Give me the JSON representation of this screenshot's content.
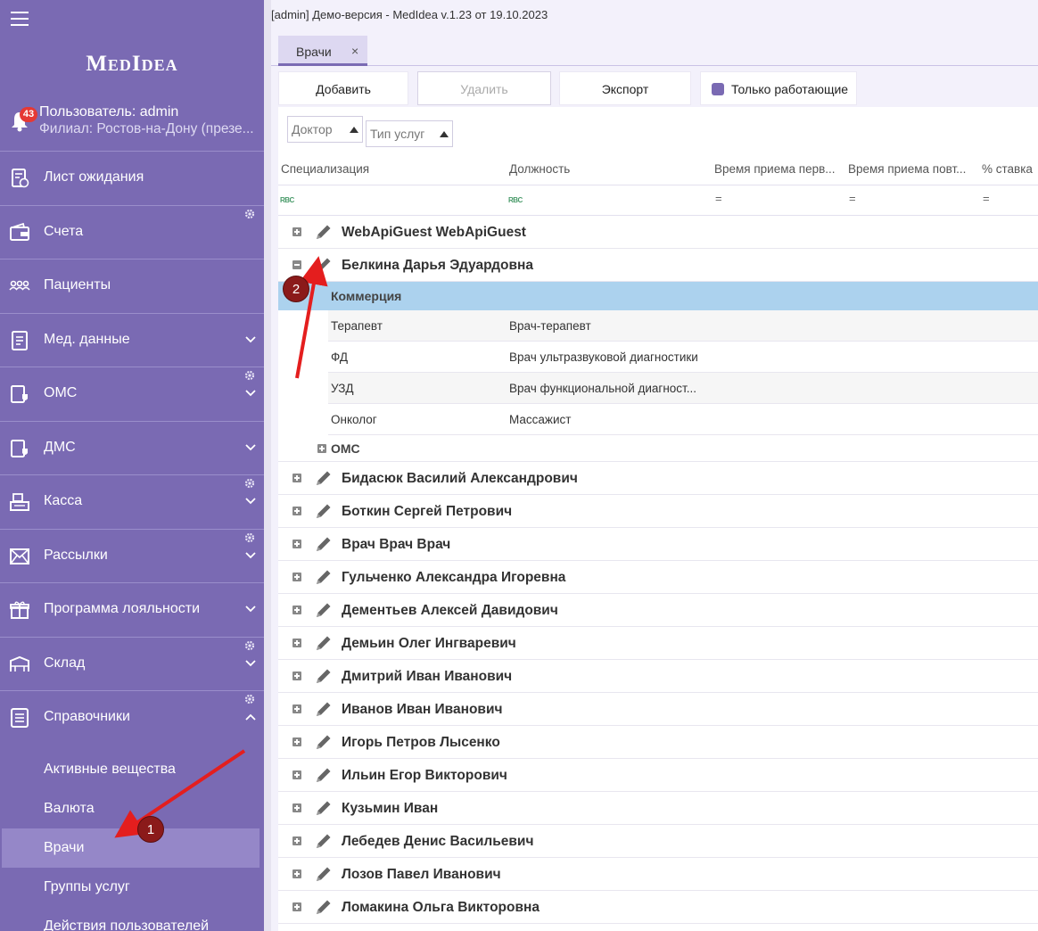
{
  "window": {
    "title": "[admin] Демо-версия  - MedIdea v.1.23 от 19.10.2023"
  },
  "sidebar": {
    "logo": "MedIdea",
    "notifications": "43",
    "user": "Пользователь: admin",
    "branch": "Филиал:  Ростов-на-Дону (презе...",
    "items": [
      {
        "label": "Лист ожидания",
        "icon": "waitlist-icon",
        "chevron": false,
        "gear": false
      },
      {
        "label": "Счета",
        "icon": "wallet-icon",
        "chevron": false,
        "gear": true
      },
      {
        "label": "Пациенты",
        "icon": "patients-icon",
        "chevron": false,
        "gear": false
      },
      {
        "label": "Мед. данные",
        "icon": "medical-data-icon",
        "chevron": true,
        "gear": false
      },
      {
        "label": "ОМС",
        "icon": "oms-icon",
        "chevron": true,
        "gear": true
      },
      {
        "label": "ДМС",
        "icon": "dms-icon",
        "chevron": true,
        "gear": false
      },
      {
        "label": "Касса",
        "icon": "cash-register-icon",
        "chevron": true,
        "gear": true
      },
      {
        "label": "Рассылки",
        "icon": "mail-icon",
        "chevron": true,
        "gear": true
      },
      {
        "label": "Программа лояльности",
        "icon": "gift-icon",
        "chevron": true,
        "gear": false
      },
      {
        "label": "Склад",
        "icon": "warehouse-icon",
        "chevron": true,
        "gear": true
      },
      {
        "label": "Справочники",
        "icon": "reference-icon",
        "chevron": true,
        "gear": true,
        "expanded": true
      }
    ],
    "submenu": [
      {
        "label": "Активные вещества",
        "active": false
      },
      {
        "label": "Валюта",
        "active": false
      },
      {
        "label": "Врачи",
        "active": true
      },
      {
        "label": "Группы услуг",
        "active": false
      },
      {
        "label": "Действия пользователей",
        "active": false
      }
    ]
  },
  "tabs": [
    {
      "label": "Врачи",
      "close": "×"
    }
  ],
  "toolbar": {
    "add": "Добавить",
    "delete": "Удалить",
    "export": "Экспорт",
    "only_working": "Только работающие"
  },
  "filters": {
    "doctor": "Доктор",
    "service_type": "Тип услуг"
  },
  "columns": [
    "Специализация",
    "Должность",
    "Время приема перв...",
    "Время приема повт...",
    "% ставка"
  ],
  "filter_row": {
    "text_icon": "RBC",
    "eq": "="
  },
  "doctors_before": [
    {
      "name": "WebApiGuest WebApiGuest",
      "expanded": false
    }
  ],
  "expanded_doctor": {
    "name": "Белкина Дарья Эдуардовна",
    "group1": "Коммерция",
    "specs": [
      {
        "spec": "Терапевт",
        "position": "Врач-терапевт"
      },
      {
        "spec": "ФД",
        "position": "Врач ультразвуковой диагностики"
      },
      {
        "spec": "УЗД",
        "position": "Врач функциональной диагност..."
      },
      {
        "spec": "Онколог",
        "position": "Массажист"
      }
    ],
    "group2": "ОМС"
  },
  "doctors_after": [
    "Бидасюк Василий Александрович",
    "Боткин Сергей Петрович",
    "Врач Врач Врач",
    "Гульченко Александра Игоревна",
    "Дементьев Алексей Давидович",
    "Демьин Олег Ингваревич",
    "Дмитрий Иван Иванович",
    "Иванов Иван Иванович",
    "Игорь Петров Лысенко",
    "Ильин Егор Викторович",
    "Кузьмин Иван",
    "Лебедев Денис Васильевич",
    "Лозов Павел Иванович",
    "Ломакина Ольга Викторовна"
  ],
  "annotations": {
    "marker1": "1",
    "marker2": "2",
    "arrow_color": "#e41e1e",
    "marker_color": "#8b1a1a"
  },
  "colors": {
    "sidebar": "#7a6ab3",
    "accent": "#7a6ab3",
    "group_highlight": "#acd2ee",
    "active_item": "#9587c8"
  }
}
